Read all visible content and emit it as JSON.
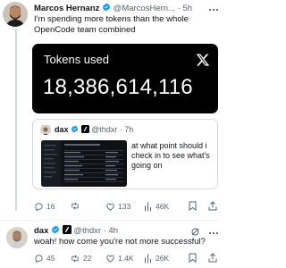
{
  "tweet1": {
    "author_name": "Marcos Hernanz",
    "handle": "@MarcosHern...",
    "separator": "·",
    "time": "5h",
    "text": "I'm spending more tokens than the whole OpenCode team combined",
    "card": {
      "title": "Tokens used",
      "value": "18,386,614,116"
    },
    "quote": {
      "author_name": "dax",
      "handle": "@thdxr",
      "separator": "·",
      "time": "7h",
      "text": "at what point should i check in to see what's going on"
    },
    "actions": {
      "replies": "16",
      "retweets": "",
      "likes": "133",
      "views": "46K"
    }
  },
  "tweet2": {
    "author_name": "dax",
    "handle": "@thdxr",
    "separator": "·",
    "time": "4h",
    "text": "woah! how come you're not more successful?",
    "actions": {
      "replies": "45",
      "retweets": "22",
      "likes": "1.4K",
      "views": "26K"
    }
  },
  "colors": {
    "verified": "#1d9bf0",
    "muted": "#536471",
    "card_bg": "#000000"
  },
  "icons": [
    "verified-badge-icon",
    "affiliate-badge-icon",
    "x-logo-icon",
    "reply-icon",
    "retweet-icon",
    "like-icon",
    "views-icon",
    "bookmark-icon",
    "share-icon",
    "grok-icon"
  ]
}
